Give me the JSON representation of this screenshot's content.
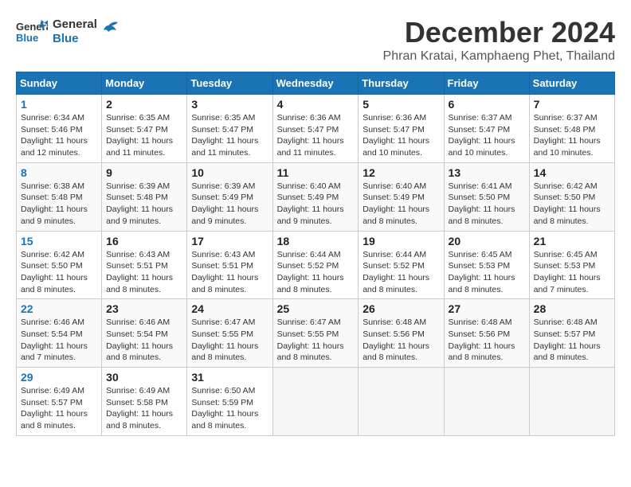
{
  "logo": {
    "line1": "General",
    "line2": "Blue"
  },
  "title": "December 2024",
  "location": "Phran Kratai, Kamphaeng Phet, Thailand",
  "weekdays": [
    "Sunday",
    "Monday",
    "Tuesday",
    "Wednesday",
    "Thursday",
    "Friday",
    "Saturday"
  ],
  "weeks": [
    [
      {
        "day": "1",
        "sunrise": "6:34 AM",
        "sunset": "5:46 PM",
        "daylight": "11 hours and 12 minutes."
      },
      {
        "day": "2",
        "sunrise": "6:35 AM",
        "sunset": "5:47 PM",
        "daylight": "11 hours and 11 minutes."
      },
      {
        "day": "3",
        "sunrise": "6:35 AM",
        "sunset": "5:47 PM",
        "daylight": "11 hours and 11 minutes."
      },
      {
        "day": "4",
        "sunrise": "6:36 AM",
        "sunset": "5:47 PM",
        "daylight": "11 hours and 11 minutes."
      },
      {
        "day": "5",
        "sunrise": "6:36 AM",
        "sunset": "5:47 PM",
        "daylight": "11 hours and 10 minutes."
      },
      {
        "day": "6",
        "sunrise": "6:37 AM",
        "sunset": "5:47 PM",
        "daylight": "11 hours and 10 minutes."
      },
      {
        "day": "7",
        "sunrise": "6:37 AM",
        "sunset": "5:48 PM",
        "daylight": "11 hours and 10 minutes."
      }
    ],
    [
      {
        "day": "8",
        "sunrise": "6:38 AM",
        "sunset": "5:48 PM",
        "daylight": "11 hours and 9 minutes."
      },
      {
        "day": "9",
        "sunrise": "6:39 AM",
        "sunset": "5:48 PM",
        "daylight": "11 hours and 9 minutes."
      },
      {
        "day": "10",
        "sunrise": "6:39 AM",
        "sunset": "5:49 PM",
        "daylight": "11 hours and 9 minutes."
      },
      {
        "day": "11",
        "sunrise": "6:40 AM",
        "sunset": "5:49 PM",
        "daylight": "11 hours and 9 minutes."
      },
      {
        "day": "12",
        "sunrise": "6:40 AM",
        "sunset": "5:49 PM",
        "daylight": "11 hours and 8 minutes."
      },
      {
        "day": "13",
        "sunrise": "6:41 AM",
        "sunset": "5:50 PM",
        "daylight": "11 hours and 8 minutes."
      },
      {
        "day": "14",
        "sunrise": "6:42 AM",
        "sunset": "5:50 PM",
        "daylight": "11 hours and 8 minutes."
      }
    ],
    [
      {
        "day": "15",
        "sunrise": "6:42 AM",
        "sunset": "5:50 PM",
        "daylight": "11 hours and 8 minutes."
      },
      {
        "day": "16",
        "sunrise": "6:43 AM",
        "sunset": "5:51 PM",
        "daylight": "11 hours and 8 minutes."
      },
      {
        "day": "17",
        "sunrise": "6:43 AM",
        "sunset": "5:51 PM",
        "daylight": "11 hours and 8 minutes."
      },
      {
        "day": "18",
        "sunrise": "6:44 AM",
        "sunset": "5:52 PM",
        "daylight": "11 hours and 8 minutes."
      },
      {
        "day": "19",
        "sunrise": "6:44 AM",
        "sunset": "5:52 PM",
        "daylight": "11 hours and 8 minutes."
      },
      {
        "day": "20",
        "sunrise": "6:45 AM",
        "sunset": "5:53 PM",
        "daylight": "11 hours and 8 minutes."
      },
      {
        "day": "21",
        "sunrise": "6:45 AM",
        "sunset": "5:53 PM",
        "daylight": "11 hours and 7 minutes."
      }
    ],
    [
      {
        "day": "22",
        "sunrise": "6:46 AM",
        "sunset": "5:54 PM",
        "daylight": "11 hours and 7 minutes."
      },
      {
        "day": "23",
        "sunrise": "6:46 AM",
        "sunset": "5:54 PM",
        "daylight": "11 hours and 8 minutes."
      },
      {
        "day": "24",
        "sunrise": "6:47 AM",
        "sunset": "5:55 PM",
        "daylight": "11 hours and 8 minutes."
      },
      {
        "day": "25",
        "sunrise": "6:47 AM",
        "sunset": "5:55 PM",
        "daylight": "11 hours and 8 minutes."
      },
      {
        "day": "26",
        "sunrise": "6:48 AM",
        "sunset": "5:56 PM",
        "daylight": "11 hours and 8 minutes."
      },
      {
        "day": "27",
        "sunrise": "6:48 AM",
        "sunset": "5:56 PM",
        "daylight": "11 hours and 8 minutes."
      },
      {
        "day": "28",
        "sunrise": "6:48 AM",
        "sunset": "5:57 PM",
        "daylight": "11 hours and 8 minutes."
      }
    ],
    [
      {
        "day": "29",
        "sunrise": "6:49 AM",
        "sunset": "5:57 PM",
        "daylight": "11 hours and 8 minutes."
      },
      {
        "day": "30",
        "sunrise": "6:49 AM",
        "sunset": "5:58 PM",
        "daylight": "11 hours and 8 minutes."
      },
      {
        "day": "31",
        "sunrise": "6:50 AM",
        "sunset": "5:59 PM",
        "daylight": "11 hours and 8 minutes."
      },
      null,
      null,
      null,
      null
    ]
  ],
  "labels": {
    "sunrise": "Sunrise:",
    "sunset": "Sunset:",
    "daylight": "Daylight:"
  }
}
